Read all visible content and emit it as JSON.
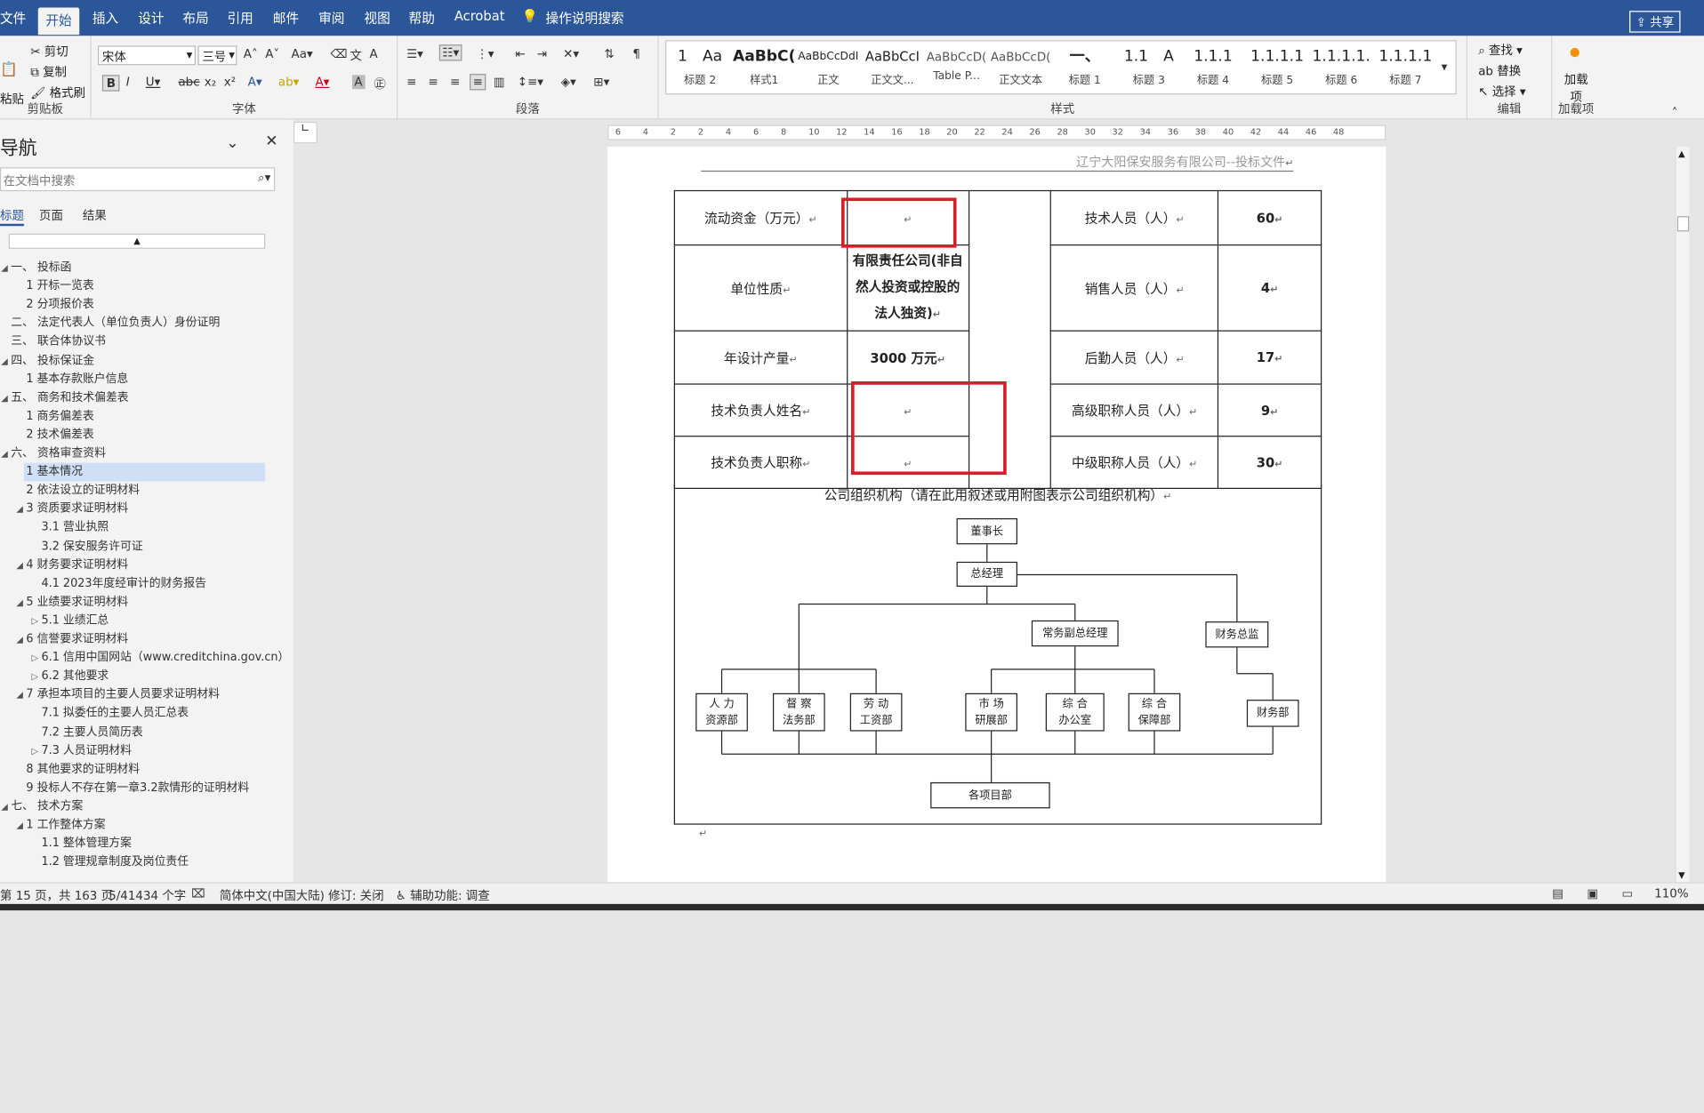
{
  "ribbon_tabs": [
    "文件",
    "开始",
    "插入",
    "设计",
    "布局",
    "引用",
    "邮件",
    "审阅",
    "视图",
    "帮助",
    "Acrobat",
    "操作说明搜索"
  ],
  "share_label": "共享",
  "clipboard": {
    "paste": "粘贴",
    "cut": "剪切",
    "copy": "复制",
    "format_painter": "格式刷",
    "label": "剪贴板"
  },
  "font": {
    "name": "宋体",
    "size": "三号",
    "label": "字体"
  },
  "paragraph_label": "段落",
  "styles": {
    "label": "样式",
    "items": [
      {
        "preview": "1　Aa",
        "name": "标题 2"
      },
      {
        "preview": "AaBbC(",
        "name": "样式1"
      },
      {
        "preview": "AaBbCcDdI",
        "name": "正文"
      },
      {
        "preview": "AaBbCcI",
        "name": "正文文..."
      },
      {
        "preview": "AaBbCcD(",
        "name": "Table P..."
      },
      {
        "preview": "AaBbCcD(",
        "name": "正文文本"
      },
      {
        "preview": "一、",
        "name": "标题 1"
      },
      {
        "preview": "1.1　A",
        "name": "标题 3"
      },
      {
        "preview": "1.1.1",
        "name": "标题 4"
      },
      {
        "preview": "1.1.1.1",
        "name": "标题 5"
      },
      {
        "preview": "1.1.1.1.",
        "name": "标题 6"
      },
      {
        "preview": "1.1.1.1",
        "name": "标题 7"
      }
    ]
  },
  "editing": {
    "find": "查找",
    "replace": "替换",
    "select": "选择",
    "label": "编辑"
  },
  "addins": {
    "add": "加载项",
    "label": "加载项"
  },
  "nav": {
    "title": "导航",
    "search_placeholder": "在文档中搜索",
    "tabs": [
      "标题",
      "页面",
      "结果"
    ],
    "items": [
      {
        "label": "一、 投标函",
        "level": 0,
        "expand": "open"
      },
      {
        "label": "1 开标一览表",
        "level": 1
      },
      {
        "label": "2 分项报价表",
        "level": 1
      },
      {
        "label": "二、 法定代表人（单位负责人）身份证明",
        "level": 0
      },
      {
        "label": "三、 联合体协议书",
        "level": 0
      },
      {
        "label": "四、 投标保证金",
        "level": 0,
        "expand": "open"
      },
      {
        "label": "1 基本存款账户信息",
        "level": 1
      },
      {
        "label": "五、 商务和技术偏差表",
        "level": 0,
        "expand": "open"
      },
      {
        "label": "1 商务偏差表",
        "level": 1
      },
      {
        "label": "2 技术偏差表",
        "level": 1
      },
      {
        "label": "六、 资格审查资料",
        "level": 0,
        "expand": "open"
      },
      {
        "label": "1 基本情况",
        "level": 1,
        "selected": true
      },
      {
        "label": "2 依法设立的证明材料",
        "level": 1
      },
      {
        "label": "3 资质要求证明材料",
        "level": 1,
        "expand": "open"
      },
      {
        "label": "3.1 营业执照",
        "level": 2
      },
      {
        "label": "3.2 保安服务许可证",
        "level": 2
      },
      {
        "label": "4 财务要求证明材料",
        "level": 1,
        "expand": "open"
      },
      {
        "label": "4.1 2023年度经审计的财务报告",
        "level": 2
      },
      {
        "label": "5 业绩要求证明材料",
        "level": 1,
        "expand": "open"
      },
      {
        "label": "5.1 业绩汇总",
        "level": 2,
        "expand": "closed"
      },
      {
        "label": "6 信誉要求证明材料",
        "level": 1,
        "expand": "open"
      },
      {
        "label": "6.1 信用中国网站（www.creditchina.gov.cn）",
        "level": 2,
        "expand": "closed"
      },
      {
        "label": "6.2 其他要求",
        "level": 2,
        "expand": "closed"
      },
      {
        "label": "7 承担本项目的主要人员要求证明材料",
        "level": 1,
        "expand": "open"
      },
      {
        "label": "7.1 拟委任的主要人员汇总表",
        "level": 2
      },
      {
        "label": "7.2 主要人员简历表",
        "level": 2
      },
      {
        "label": "7.3 人员证明材料",
        "level": 2,
        "expand": "closed"
      },
      {
        "label": "8 其他要求的证明材料",
        "level": 1
      },
      {
        "label": "9 投标人不存在第一章3.2款情形的证明材料",
        "level": 1
      },
      {
        "label": "七、 技术方案",
        "level": 0,
        "expand": "open"
      },
      {
        "label": "1 工作整体方案",
        "level": 1,
        "expand": "open"
      },
      {
        "label": "1.1 整体管理方案",
        "level": 2
      },
      {
        "label": "1.2 管理规章制度及岗位责任",
        "level": 2
      }
    ]
  },
  "ruler": [
    "6",
    "4",
    "2",
    "2",
    "4",
    "6",
    "8",
    "10",
    "12",
    "14",
    "16",
    "18",
    "20",
    "22",
    "24",
    "26",
    "28",
    "30",
    "32",
    "34",
    "36",
    "38",
    "40",
    "42",
    "44",
    "46",
    "48"
  ],
  "doc": {
    "header": "辽宁大阳保安服务有限公司--投标文件",
    "para_mark": "↵",
    "table": {
      "r1": {
        "l1": "流动资金（万元）",
        "v1": "",
        "l2": "技术人员（人）",
        "v2": "60"
      },
      "r2": {
        "l1": "单位性质",
        "v1": "有限责任公司(非自然人投资或控股的法人独资)",
        "l2": "销售人员（人）",
        "v2": "4"
      },
      "r3": {
        "l1": "年设计产量",
        "v1": "3000 万元",
        "l2": "后勤人员（人）",
        "v2": "17"
      },
      "r4": {
        "l1": "技术负责人姓名",
        "v1": "",
        "l2": "高级职称人员（人）",
        "v2": "9"
      },
      "r5": {
        "l1": "技术负责人职称",
        "v1": "",
        "l2": "中级职称人员（人）",
        "v2": "30"
      }
    },
    "org_title": "公司组织机构（请在此用叙述或用附图表示公司组织机构）",
    "org": {
      "chairman": "董事长",
      "gm": "总经理",
      "deputy": "常务副总经理",
      "cfo": "财务总监",
      "hr": "人 力\n资源部",
      "audit": "督 察\n法务部",
      "labor": "劳 动\n工资部",
      "market": "市 场\n研展部",
      "office": "综 合\n办公室",
      "support": "综 合\n保障部",
      "finance": "财务部",
      "projects": "各项目部"
    }
  },
  "status": {
    "page": "第 15 页，共 163 页",
    "words": "5/41434 个字",
    "lang": "简体中文(中国大陆)",
    "track": "修订: 关闭",
    "access": "辅助功能: 调查",
    "zoom": "110%"
  }
}
